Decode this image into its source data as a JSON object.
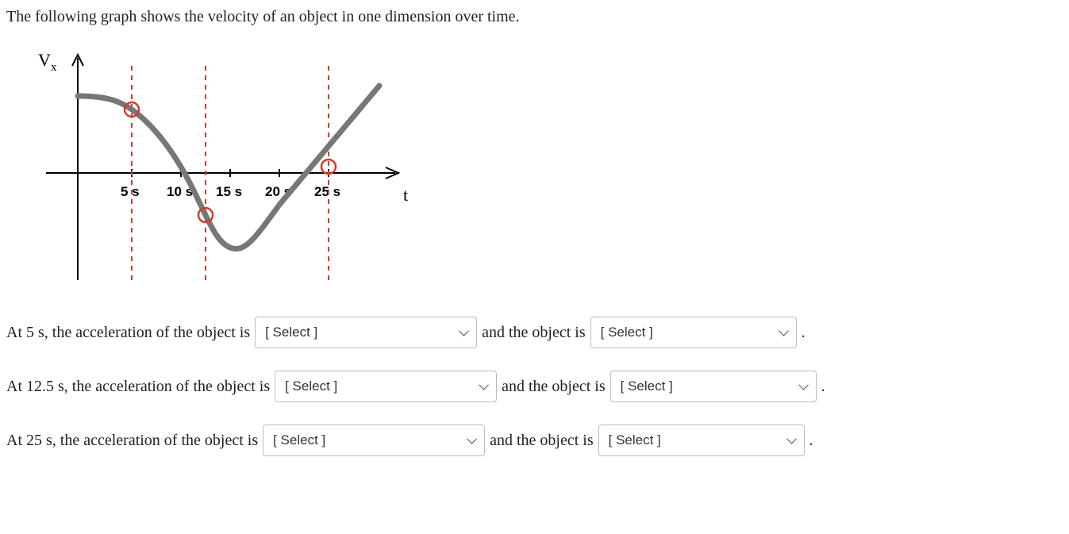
{
  "intro": "The following graph shows the velocity of an object in one dimension over time.",
  "graph": {
    "y_label": "V",
    "y_label_sub": "x",
    "x_label": "t",
    "ticks": [
      "5 s",
      "10 s",
      "15 s",
      "20 s",
      "25 s"
    ],
    "highlight_times": [
      "5 s",
      "12.5 s",
      "25 s"
    ]
  },
  "questions": [
    {
      "lead": "At 5 s, the acceleration of the object is",
      "mid": "and the object is",
      "select_placeholder": "[ Select ]",
      "tail": "."
    },
    {
      "lead": "At 12.5 s, the acceleration of the object is",
      "mid": "and the object is",
      "select_placeholder": "[ Select ]",
      "tail": "."
    },
    {
      "lead": "At 25 s, the acceleration of the object is",
      "mid": "and the object is",
      "select_placeholder": "[ Select ]",
      "tail": "."
    }
  ],
  "chart_data": {
    "type": "line",
    "title": "",
    "xlabel": "t",
    "ylabel": "Vx",
    "x_unit": "s",
    "x_ticks": [
      5,
      10,
      15,
      20,
      25
    ],
    "description": "Velocity starts positive and roughly flat near t=0, curves downward (negative slope) passing a marked point near 5 s, crosses zero between 10 s and 12.5 s, reaches a negative minimum around 15 s, then rises linearly, crossing zero again near 25 s (marked) and continuing positive.",
    "series": [
      {
        "name": "Vx (relative units, estimated from graph)",
        "x": [
          0,
          5,
          10,
          12.5,
          15,
          20,
          25,
          27
        ],
        "y": [
          95,
          80,
          20,
          -50,
          -95,
          -40,
          10,
          30
        ]
      }
    ],
    "marked_points_t": [
      5,
      12.5,
      25
    ],
    "xlim": [
      0,
      30
    ],
    "ylim": [
      -120,
      120
    ]
  }
}
